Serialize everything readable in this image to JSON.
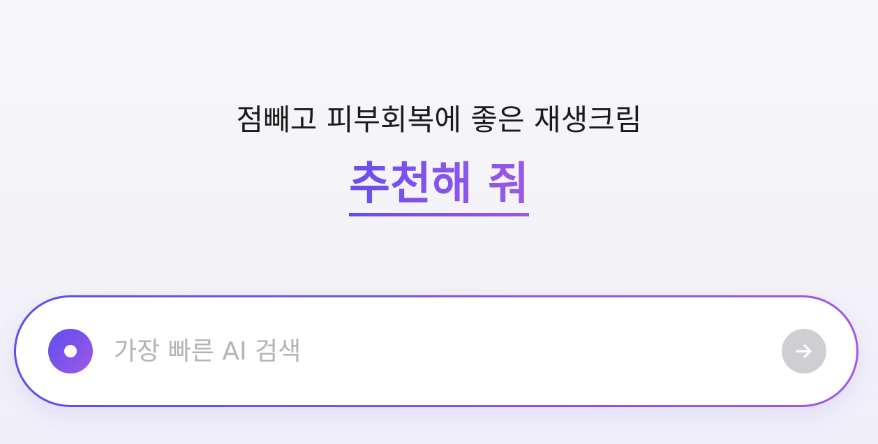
{
  "hero": {
    "subtitle": "점빼고 피부회복에 좋은 재생크림",
    "headline": "추천해 줘"
  },
  "search": {
    "placeholder": "가장 빠른 AI 검색",
    "value": ""
  },
  "icons": {
    "logo": "ai-logo-dot-icon",
    "submit": "arrow-right-icon"
  },
  "colors": {
    "accent_start": "#5a4ff0",
    "accent_end": "#a257e6",
    "submit_disabled": "#cfcfd3"
  }
}
